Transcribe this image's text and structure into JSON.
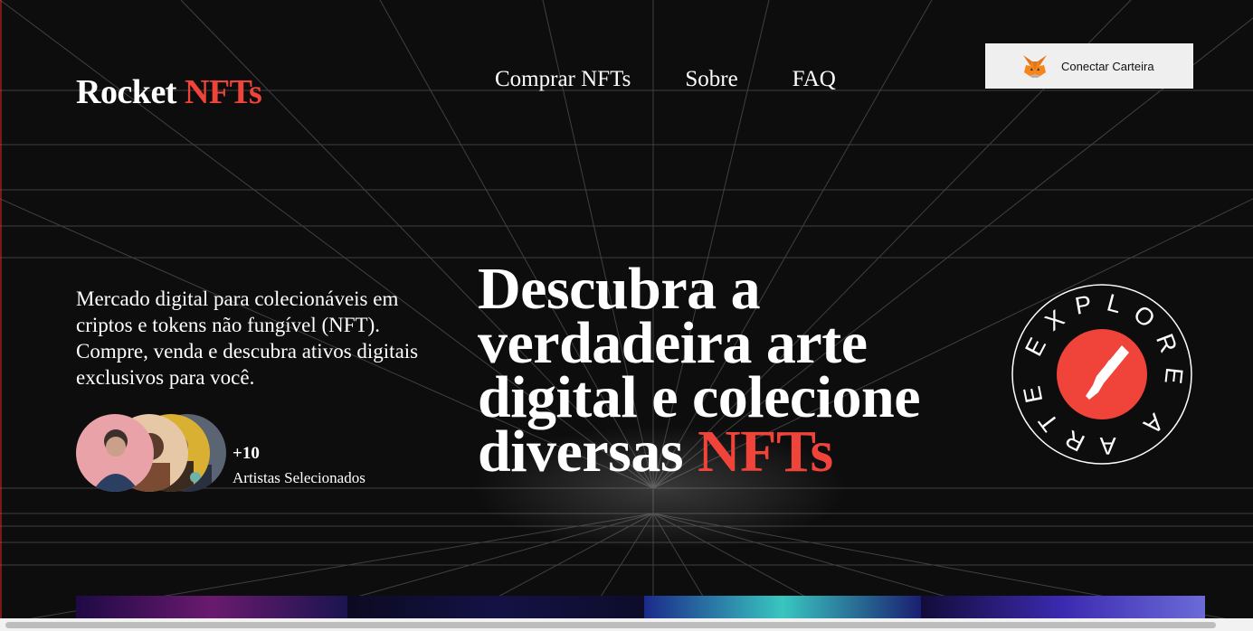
{
  "brand": {
    "name": "Rocket",
    "accent": "NFTs",
    "accent_color": "#f0433a"
  },
  "nav": [
    {
      "label": "Comprar NFTs"
    },
    {
      "label": "Sobre"
    },
    {
      "label": "FAQ"
    }
  ],
  "wallet": {
    "label": "Conectar Carteira",
    "icon": "metamask-fox-icon"
  },
  "intro": {
    "text": "Mercado digital para colecionáveis em criptos e tokens não fungível (NFT). Compre, venda e descubra ativos digitais exclusivos para você."
  },
  "artists": {
    "count": "+10",
    "label": "Artistas Selecionados"
  },
  "headline": {
    "main": "Descubra a verdadeira arte digital e colecione diversas",
    "accent": "NFTs"
  },
  "badge": {
    "ring_text": "EXPLORE A ARTE",
    "icon": "brush-icon",
    "color": "#f0433a"
  },
  "colors": {
    "background": "#0d0d0d",
    "accent": "#f0433a",
    "text": "#ffffff"
  }
}
